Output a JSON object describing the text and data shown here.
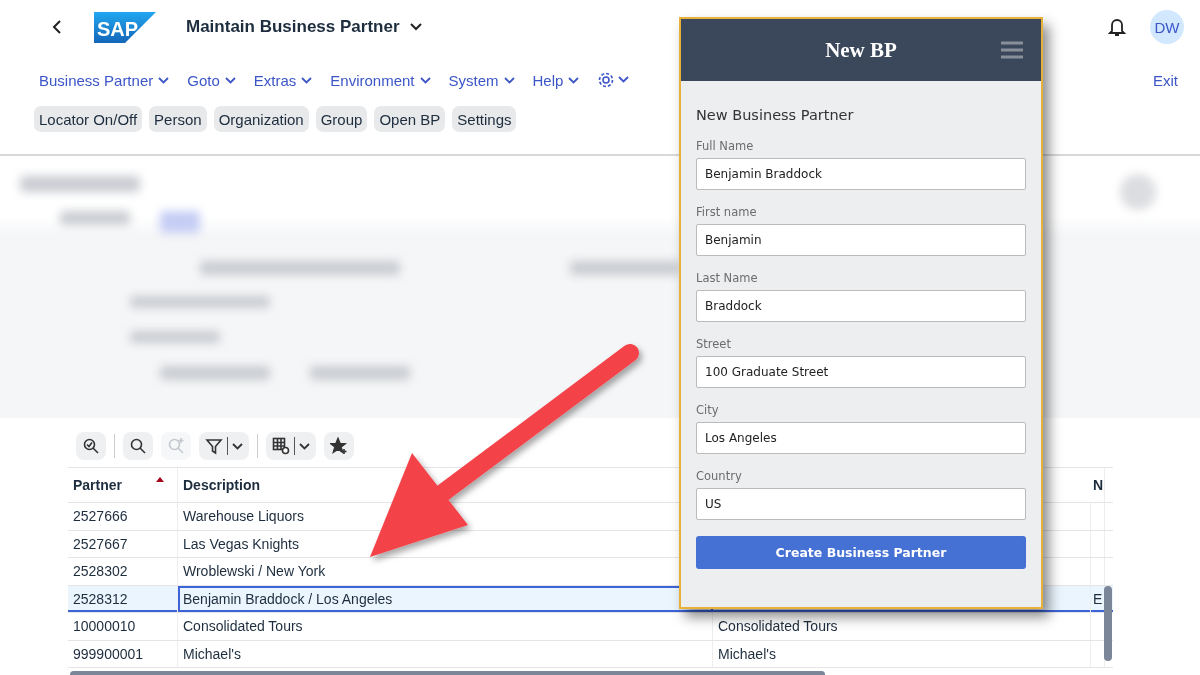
{
  "header": {
    "logo": "SAP",
    "title": "Maintain Business Partner",
    "avatar": "DW"
  },
  "menu": [
    {
      "kind": "text",
      "label": "Business Partner"
    },
    {
      "kind": "text",
      "label": "Goto"
    },
    {
      "kind": "text",
      "label": "Extras"
    },
    {
      "kind": "text",
      "label": "Environment"
    },
    {
      "kind": "text",
      "label": "System"
    },
    {
      "kind": "text",
      "label": "Help"
    },
    {
      "kind": "gear"
    }
  ],
  "exit": "Exit",
  "actions": [
    "Locator On/Off",
    "Person",
    "Organization",
    "Group",
    "Open BP",
    "Settings"
  ],
  "table": {
    "tools": [
      {
        "kind": "zoom-check",
        "disabled": false
      },
      {
        "kind": "search",
        "disabled": false
      },
      {
        "kind": "zoom-in",
        "disabled": true
      },
      {
        "kind": "filter",
        "disabled": false
      },
      {
        "kind": "table-settings",
        "disabled": false
      },
      {
        "kind": "star-plus",
        "disabled": false
      }
    ],
    "columns": [
      {
        "label": "Partner",
        "sorted": true
      },
      {
        "label": "Description",
        "sorted": false
      },
      {
        "label": "N",
        "sorted": false
      }
    ],
    "rows": [
      {
        "partner": "2527666",
        "description": "Warehouse Liquors",
        "selected": false
      },
      {
        "partner": "2527667",
        "description": "Las Vegas Knights",
        "selected": false
      },
      {
        "partner": "2528302",
        "description": "Wroblewski / New York",
        "selected": false
      },
      {
        "partner": "2528312",
        "description": "Benjamin Braddock / Los Angeles",
        "column_4": "E",
        "selected": true
      },
      {
        "partner": "10000010",
        "description": "Consolidated Tours",
        "column_3": "Consolidated Tours",
        "selected": false
      },
      {
        "partner": "999900001",
        "description": "Michael's",
        "column_3": "Michael's",
        "selected": false
      }
    ]
  },
  "dialog": {
    "title": "New BP",
    "heading": "New Business Partner",
    "fields": [
      {
        "label": "Full Name",
        "value": "Benjamin Braddock"
      },
      {
        "label": "First name",
        "value": "Benjamin"
      },
      {
        "label": "Last Name",
        "value": "Braddock"
      },
      {
        "label": "Street",
        "value": "100 Graduate Street"
      },
      {
        "label": "City",
        "value": "Los Angeles"
      },
      {
        "label": "Country",
        "value": "US"
      }
    ],
    "button": "Create Business Partner"
  }
}
